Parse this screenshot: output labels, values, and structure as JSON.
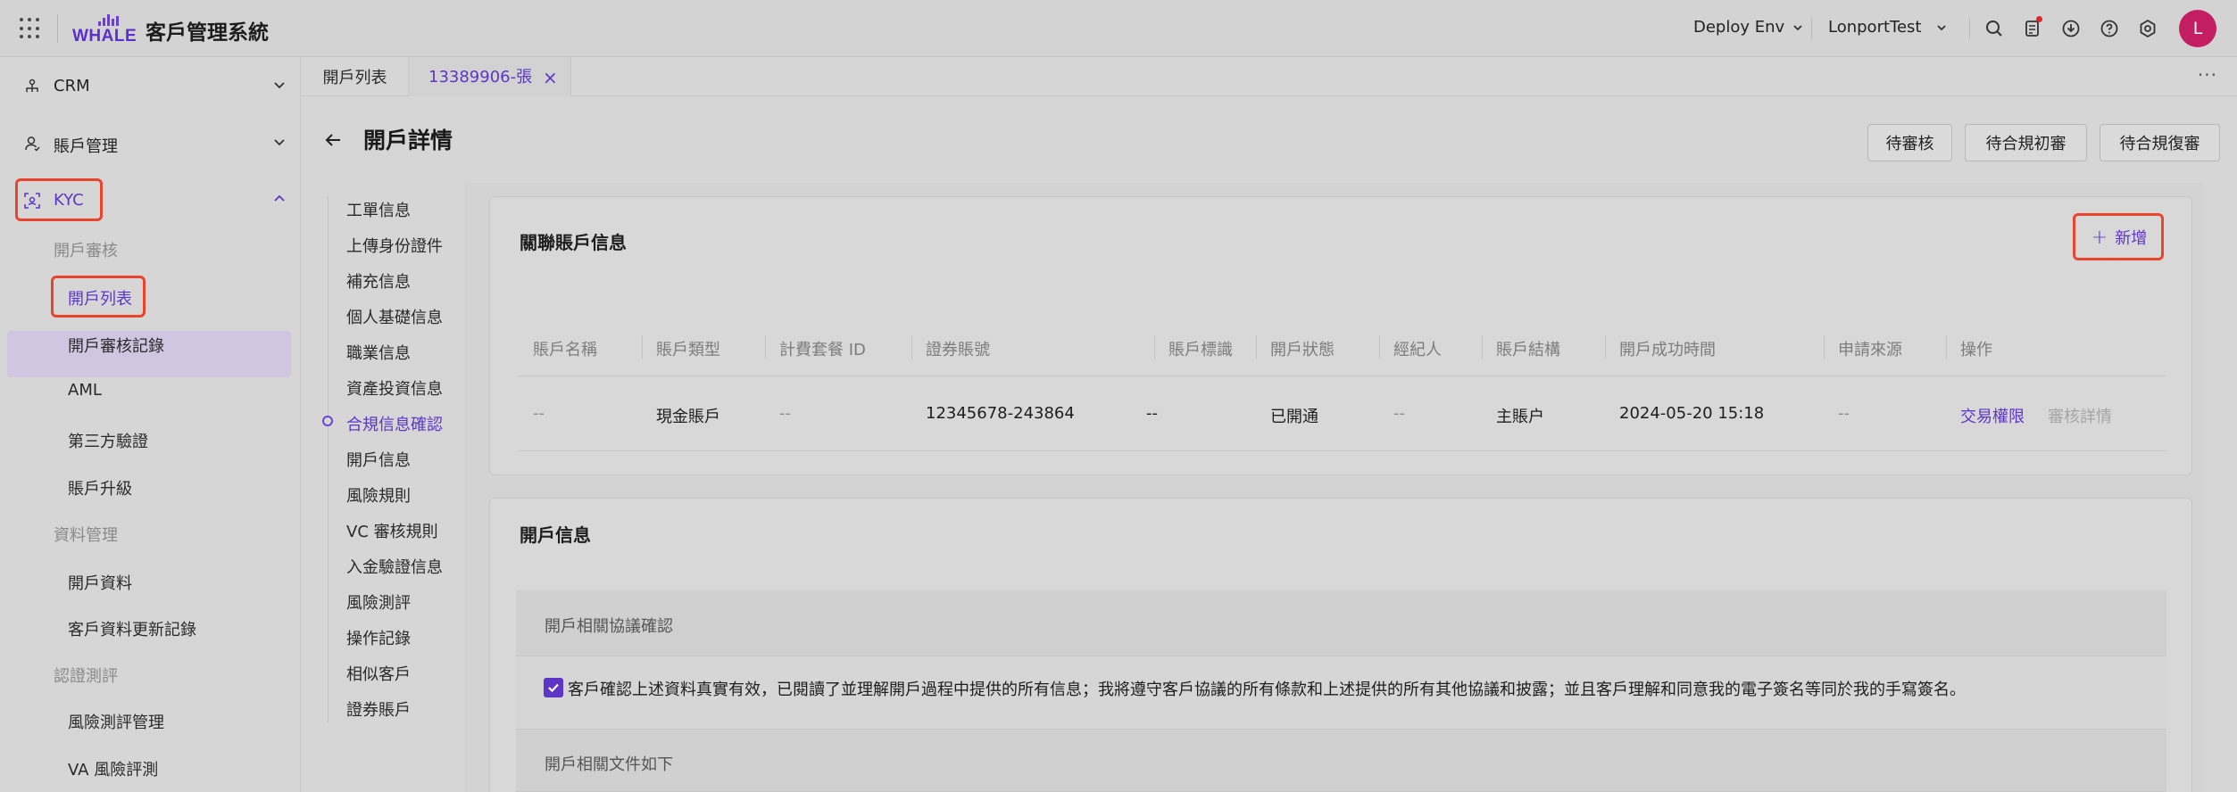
{
  "topbar": {
    "app_title": "客戶管理系統",
    "logo_text": "WHALE",
    "env_label": "Deploy Env",
    "user_label": "LonportTest",
    "avatar_letter": "L"
  },
  "sidebar": {
    "groups": [
      {
        "label": "CRM",
        "icon": "network-icon"
      },
      {
        "label": "賬戶管理",
        "icon": "user-icon"
      },
      {
        "label": "KYC",
        "icon": "scan-face-icon"
      }
    ],
    "sections": [
      {
        "title": "開戶審核",
        "items": [
          "開戶列表",
          "開戶審核記錄",
          "AML",
          "第三方驗證",
          "賬戶升級"
        ]
      },
      {
        "title": "資料管理",
        "items": [
          "開戶資料",
          "客戶資料更新記錄"
        ]
      },
      {
        "title": "認證測評",
        "items": [
          "風險測評管理",
          "VA 風險評測"
        ]
      }
    ],
    "active_item": "開戶列表"
  },
  "tabs": [
    {
      "label": "開戶列表"
    },
    {
      "label": "13389906-張"
    }
  ],
  "page": {
    "title": "開戶詳情",
    "actions": [
      "待審核",
      "待合規初審",
      "待合規復審"
    ]
  },
  "anchors": [
    "工單信息",
    "上傳身份證件",
    "補充信息",
    "個人基礎信息",
    "職業信息",
    "資產投資信息",
    "合規信息確認",
    "開戶信息",
    "風險規則",
    "VC 審核規則",
    "入金驗證信息",
    "風險測評",
    "操作記錄",
    "相似客戶",
    "證券賬戶"
  ],
  "active_anchor": "合規信息確認",
  "linked_accounts": {
    "title": "關聯賬戶信息",
    "add_label": "新增",
    "columns": [
      "賬戶名稱",
      "賬戶類型",
      "計費套餐 ID",
      "證券賬號",
      "賬戶標識",
      "開戶狀態",
      "經紀人",
      "賬戶結構",
      "開戶成功時間",
      "申請來源",
      "操作"
    ],
    "rows": [
      [
        "--",
        "現金賬戶",
        "--",
        "12345678-243864",
        "--",
        "已開通",
        "--",
        "主賬户",
        "2024-05-20 15:18",
        "--"
      ]
    ],
    "row_actions": [
      "交易權限",
      "審核詳情"
    ]
  },
  "account_info": {
    "title": "開戶信息",
    "agreement_title": "開戶相關協議確認",
    "agreement_text": "客戶確認上述資料真實有效，已閱讀了並理解開戶過程中提供的所有信息；我將遵守客戶協議的所有條款和上述提供的所有其他協議和披露；並且客戶理解和同意我的電子簽名等同於我的手寫簽名。",
    "documents_title": "開戶相關文件如下"
  },
  "colors": {
    "accent": "#5d36c8",
    "highlight": "#e9452e",
    "avatar": "#c41e63"
  }
}
